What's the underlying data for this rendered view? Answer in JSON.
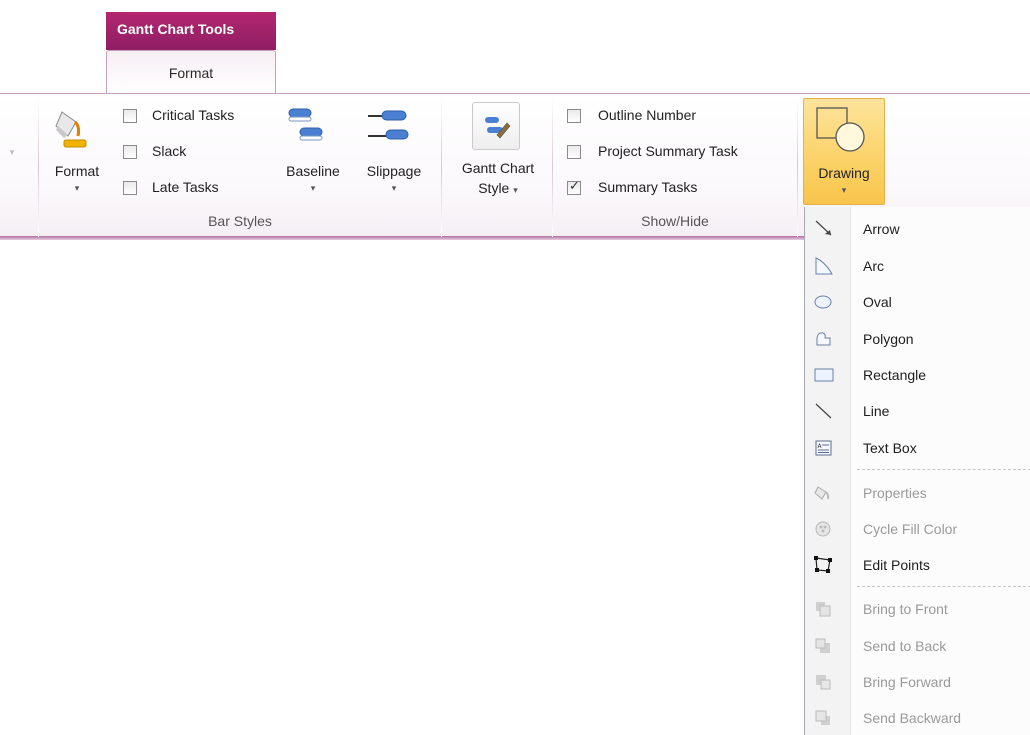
{
  "contextual_tab": {
    "title": "Gantt Chart Tools",
    "tab_label": "Format"
  },
  "ribbon": {
    "format_button": {
      "label": "Format"
    },
    "bar_styles": {
      "group_label": "Bar Styles",
      "checkboxes": [
        {
          "label": "Critical Tasks",
          "checked": false
        },
        {
          "label": "Slack",
          "checked": false
        },
        {
          "label": "Late Tasks",
          "checked": false
        }
      ],
      "baseline_label": "Baseline",
      "slippage_label": "Slippage"
    },
    "gantt_style": {
      "label_line1": "Gantt Chart",
      "label_line2": "Style"
    },
    "show_hide": {
      "group_label": "Show/Hide",
      "checkboxes": [
        {
          "label": "Outline Number",
          "checked": false
        },
        {
          "label": "Project Summary Task",
          "checked": false
        },
        {
          "label": "Summary Tasks",
          "checked": true
        }
      ]
    },
    "drawing_button": {
      "label": "Drawing"
    }
  },
  "drawing_menu": {
    "items": [
      {
        "label": "Arrow",
        "icon": "arrow-icon",
        "enabled": true
      },
      {
        "label": "Arc",
        "icon": "arc-icon",
        "enabled": true
      },
      {
        "label": "Oval",
        "icon": "oval-icon",
        "enabled": true
      },
      {
        "label": "Polygon",
        "icon": "polygon-icon",
        "enabled": true
      },
      {
        "label": "Rectangle",
        "icon": "rectangle-icon",
        "enabled": true
      },
      {
        "label": "Line",
        "icon": "line-icon",
        "enabled": true
      },
      {
        "label": "Text Box",
        "icon": "text-box-icon",
        "enabled": true
      },
      {
        "label": "Properties",
        "icon": "properties-icon",
        "enabled": false
      },
      {
        "label": "Cycle Fill Color",
        "icon": "cycle-fill-icon",
        "enabled": false
      },
      {
        "label": "Edit Points",
        "icon": "edit-points-icon",
        "enabled": true
      },
      {
        "label": "Bring to Front",
        "icon": "bring-to-front-icon",
        "enabled": false
      },
      {
        "label": "Send to Back",
        "icon": "send-to-back-icon",
        "enabled": false
      },
      {
        "label": "Bring Forward",
        "icon": "bring-forward-icon",
        "enabled": false
      },
      {
        "label": "Send Backward",
        "icon": "send-backward-icon",
        "enabled": false
      }
    ]
  },
  "colors": {
    "context_tab": "#a0226a",
    "drawing_highlight": "#fbd36b",
    "ribbon_border": "#c7a1bb"
  }
}
